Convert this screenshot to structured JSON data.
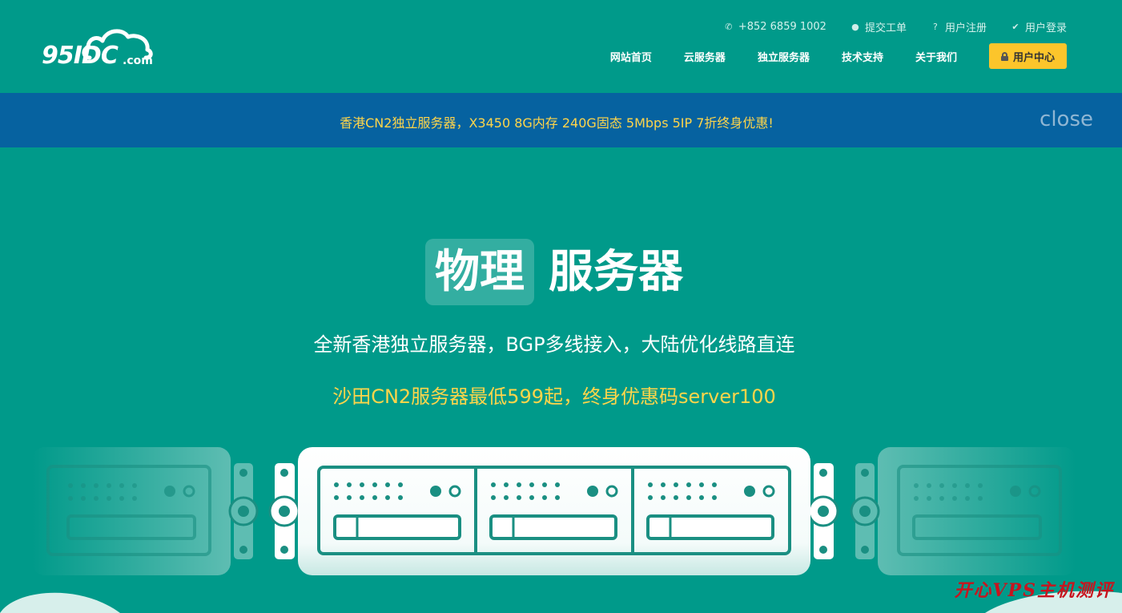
{
  "brand": {
    "logo_text": "95IDC",
    "logo_domain": ".com"
  },
  "top_links": [
    {
      "icon": "phone-icon",
      "label": "+852 6859 1002"
    },
    {
      "icon": "chat-icon",
      "label": "提交工单"
    },
    {
      "icon": "question-icon",
      "label": "用户注册"
    },
    {
      "icon": "check-icon",
      "label": "用户登录"
    }
  ],
  "nav": {
    "items": [
      "网站首页",
      "云服务器",
      "独立服务器",
      "技术支持",
      "关于我们"
    ],
    "user_center": "用户中心"
  },
  "banner": {
    "text": "香港CN2独立服务器，X3450 8G内存 240G固态 5Mbps 5IP 7折终身优惠!",
    "close_label": "close"
  },
  "hero": {
    "title_highlight": "物理",
    "title_rest": "服务器",
    "subtitle": "全新香港独立服务器，BGP多线接入，大陆优化线路直连",
    "promo": "沙田CN2服务器最低599起，终身优惠码server100"
  },
  "watermark": "开心VPS主机测评",
  "colors": {
    "background": "#009a8a",
    "banner": "#0662a0",
    "accent_yellow": "#fcc52b",
    "promo_text": "#ffd54a"
  }
}
